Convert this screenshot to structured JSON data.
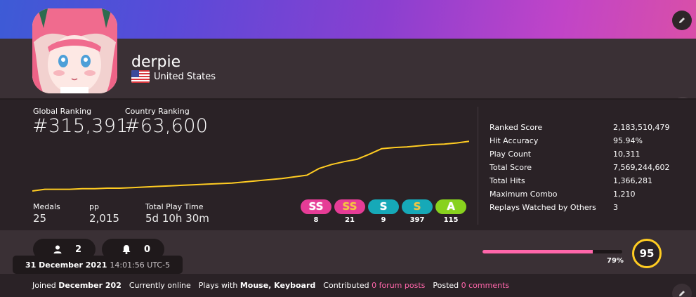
{
  "profile": {
    "username": "derpie",
    "country": "United States"
  },
  "ranking": {
    "global_label": "Global Ranking",
    "global_value": "#315,391",
    "country_label": "Country Ranking",
    "country_value": "#63,600"
  },
  "summary": {
    "medals_label": "Medals",
    "medals_value": "25",
    "pp_label": "pp",
    "pp_value": "2,015",
    "playtime_label": "Total Play Time",
    "playtime_value": "5d 10h 30m"
  },
  "grades": [
    {
      "label": "SS",
      "count": "8",
      "color": "#e63c96",
      "text": "#ffffff",
      "shadow": "#ffffff"
    },
    {
      "label": "SS",
      "count": "21",
      "color": "#e63c96",
      "text": "#f4c542",
      "shadow": "#f4c542"
    },
    {
      "label": "S",
      "count": "9",
      "color": "#16a9b8",
      "text": "#ffffff",
      "shadow": "#ffffff"
    },
    {
      "label": "S",
      "count": "397",
      "color": "#16a9b8",
      "text": "#f4c542",
      "shadow": "#f4c542"
    },
    {
      "label": "A",
      "count": "115",
      "color": "#88d21e",
      "text": "#ffffff",
      "shadow": "#ffffff"
    }
  ],
  "stats": {
    "ranked_score_label": "Ranked Score",
    "ranked_score": "2,183,510,479",
    "hit_accuracy_label": "Hit Accuracy",
    "hit_accuracy": "95.94%",
    "play_count_label": "Play Count",
    "play_count": "10,311",
    "total_score_label": "Total Score",
    "total_score": "7,569,244,602",
    "total_hits_label": "Total Hits",
    "total_hits": "1,366,281",
    "max_combo_label": "Maximum Combo",
    "max_combo": "1,210",
    "replays_label": "Replays Watched by Others",
    "replays": "3"
  },
  "social": {
    "followers": "2",
    "notifications": "0"
  },
  "level": {
    "progress_percent": 79,
    "progress_label": "79%",
    "value": "95"
  },
  "tooltip": {
    "date": "31 December 2021",
    "time": "14:01:56 UTC-5"
  },
  "joined": {
    "prefix": "Joined",
    "date": "December 202",
    "online": "Currently online",
    "plays_with_prefix": "Plays with",
    "plays_with": "Mouse, Keyboard",
    "contributed_prefix": "Contributed",
    "forum_posts": "0 forum posts",
    "posted_prefix": "Posted",
    "comments": "0 comments"
  },
  "chart_data": {
    "type": "line",
    "title": "",
    "series": [
      {
        "values": [
          100,
          103,
          103,
          103,
          104,
          104,
          105,
          105,
          106,
          107,
          108,
          109,
          110,
          111,
          112,
          113,
          114,
          116,
          118,
          120,
          122,
          125,
          128,
          140,
          147,
          152,
          156,
          165,
          175,
          177,
          178,
          180,
          182,
          183,
          185,
          188
        ]
      }
    ],
    "ylim": [
      95,
      192
    ],
    "color": "#ffcc22"
  },
  "colors": {
    "accent_pink": "#ff66aa",
    "level_ring": "#ffcc22",
    "chart_line": "#ffcc22"
  }
}
